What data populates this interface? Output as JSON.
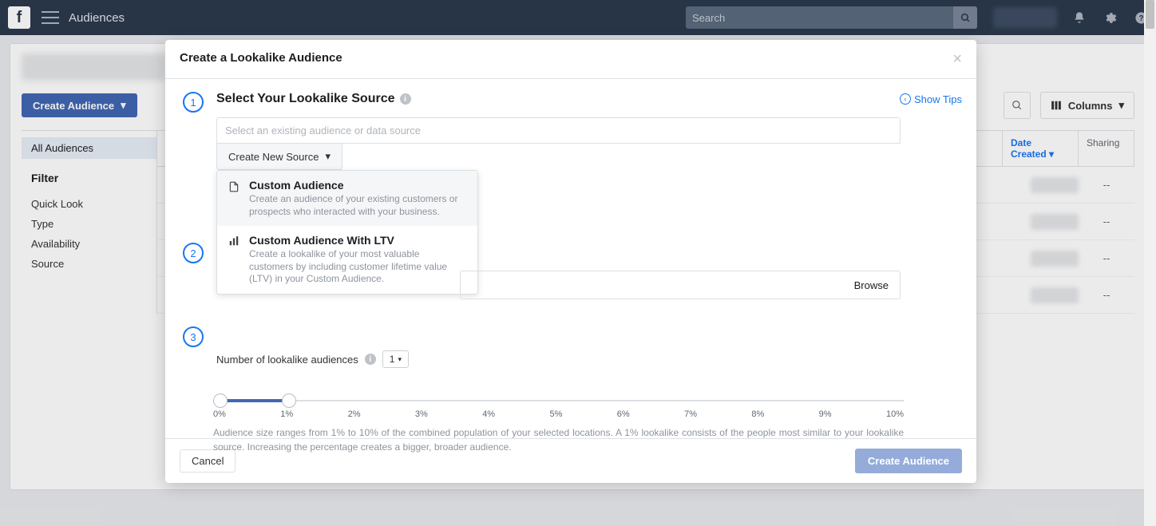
{
  "topbar": {
    "title": "Audiences",
    "search_placeholder": "Search"
  },
  "bg": {
    "create_audience_btn": "Create Audience",
    "columns_btn": "Columns",
    "sidebar_active": "All Audiences",
    "filter_heading": "Filter",
    "filters": [
      "Quick Look",
      "Type",
      "Availability",
      "Source"
    ],
    "th_date": "Date Created",
    "th_share": "Sharing",
    "share_dash": "--"
  },
  "modal": {
    "title": "Create a Lookalike Audience",
    "show_tips": "Show Tips",
    "step1": {
      "num": "1",
      "title": "Select Your Lookalike Source",
      "input_placeholder": "Select an existing audience or data source",
      "create_new": "Create New Source"
    },
    "dropdown": {
      "item1": {
        "title": "Custom Audience",
        "desc": "Create an audience of your existing customers or prospects who interacted with your business."
      },
      "item2": {
        "title": "Custom Audience With LTV",
        "desc": "Create a lookalike of your most valuable customers by including customer lifetime value (LTV) in your Custom Audience."
      }
    },
    "step2": {
      "num": "2",
      "browse": "Browse"
    },
    "step3": {
      "num": "3",
      "size_label": "Number of lookalike audiences",
      "size_value": "1"
    },
    "slider": {
      "labels": [
        "0%",
        "1%",
        "2%",
        "3%",
        "4%",
        "5%",
        "6%",
        "7%",
        "8%",
        "9%",
        "10%"
      ],
      "desc": "Audience size ranges from 1% to 10% of the combined population of your selected locations. A 1% lookalike consists of the people most similar to your lookalike source. Increasing the percentage creates a bigger, broader audience."
    },
    "footer": {
      "cancel": "Cancel",
      "create": "Create Audience"
    }
  }
}
